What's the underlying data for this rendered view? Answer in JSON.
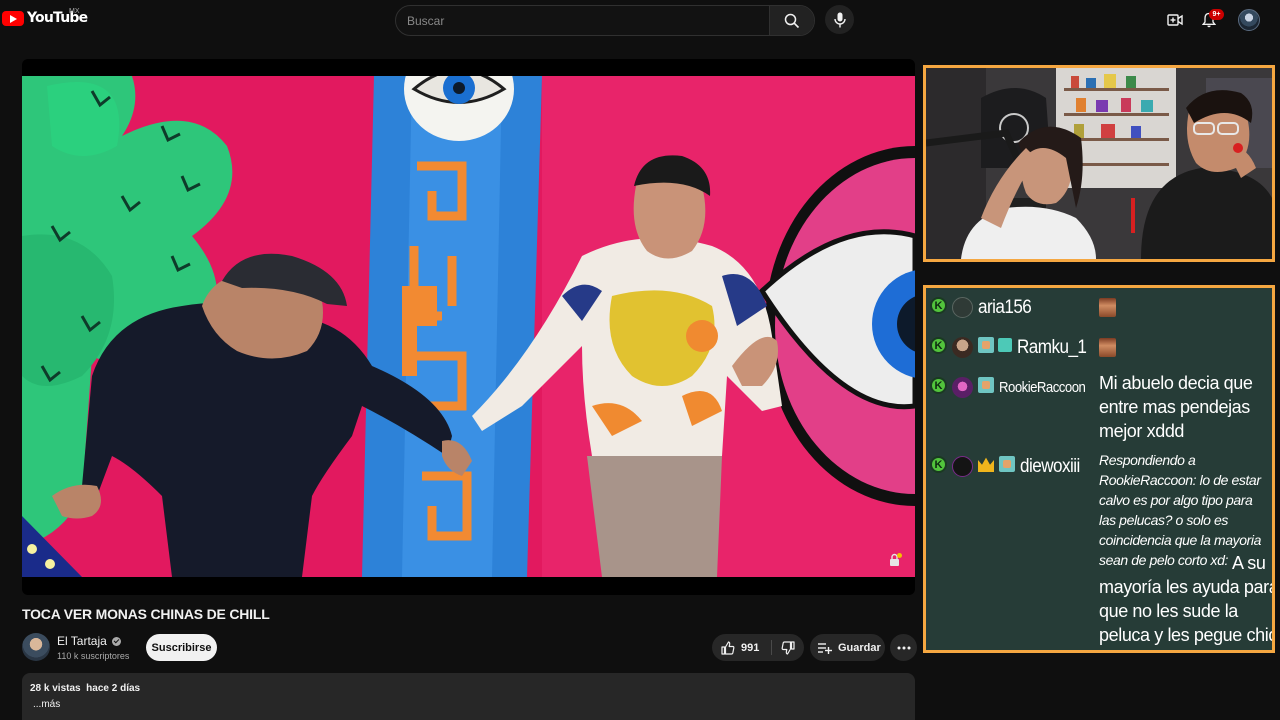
{
  "header": {
    "logo_text": "YouTube",
    "country_code": "MX",
    "search_placeholder": "Buscar",
    "notification_count": "9+",
    "icons": {
      "search": "search-icon",
      "mic": "mic-icon",
      "create": "create-video-icon",
      "notifications": "bell-icon"
    }
  },
  "video": {
    "title": "TOCA VER MONAS CHINAS DE CHILL",
    "channel_name": "El Tartaja",
    "subscribers": "110 k suscriptores",
    "subscribe_label": "Suscribirse",
    "likes": "991",
    "save_label": "Guardar",
    "views": "28 k vistas",
    "date": "hace 2 días",
    "more_label": "...más"
  },
  "chat": {
    "messages": [
      {
        "user": "aria156",
        "text": ""
      },
      {
        "user": "Ramku_1",
        "text": ""
      },
      {
        "user": "RookieRaccoon",
        "lines": [
          "Mi abuelo decia que",
          "entre mas pendejas",
          "mejor xddd"
        ]
      },
      {
        "user": "diewoxiii",
        "reply_lines": [
          "Respondiendo a",
          "RookieRaccoon: lo de estar",
          "calvo es por algo tipo para",
          "las pelucas? o solo es",
          "coincidencia que la mayoria",
          "sean de pelo corto xd:"
        ],
        "lines": [
          "A su",
          "mayoría les ayuda para",
          "que no les sude la",
          "peluca y les pegue chido"
        ]
      }
    ]
  },
  "colors": {
    "accent_overlay": "#f5a741",
    "chat_background": "#263c37",
    "kick_badge": "#52c43c",
    "youtube_red": "#ff0000"
  }
}
